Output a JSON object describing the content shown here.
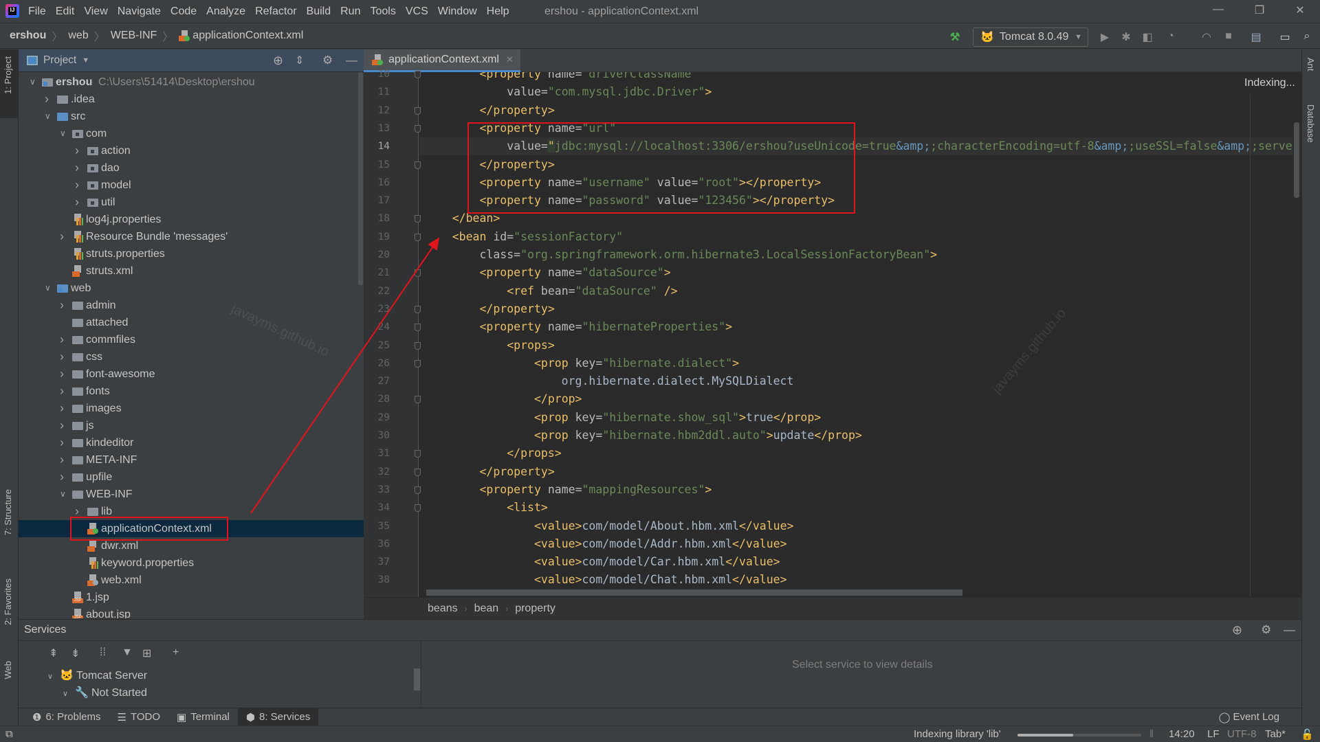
{
  "window": {
    "title": "ershou - applicationContext.xml",
    "minimize": "—",
    "restore": "❐",
    "close": "✕"
  },
  "menu": [
    "File",
    "Edit",
    "View",
    "Navigate",
    "Code",
    "Analyze",
    "Refactor",
    "Build",
    "Run",
    "Tools",
    "VCS",
    "Window",
    "Help"
  ],
  "breadcrumb": [
    "ershou",
    "web",
    "WEB-INF",
    "applicationContext.xml"
  ],
  "toolbar": {
    "run_config": "Tomcat 8.0.49",
    "build_icon": "hammer-icon"
  },
  "left_stripe": [
    "1: Project",
    "7: Structure",
    "2: Favorites",
    "Web"
  ],
  "right_stripe": [
    "Ant",
    "Database"
  ],
  "project": {
    "title": "Project",
    "tree": [
      {
        "label": "ershou",
        "path": "C:\\Users\\51414\\Desktop\\ershou",
        "depth": 0,
        "arrow": "open",
        "icon": "module"
      },
      {
        "label": ".idea",
        "depth": 1,
        "arrow": "closed",
        "icon": "folder"
      },
      {
        "label": "src",
        "depth": 1,
        "arrow": "open",
        "icon": "src"
      },
      {
        "label": "com",
        "depth": 2,
        "arrow": "open",
        "icon": "package"
      },
      {
        "label": "action",
        "depth": 3,
        "arrow": "closed",
        "icon": "package"
      },
      {
        "label": "dao",
        "depth": 3,
        "arrow": "closed",
        "icon": "package"
      },
      {
        "label": "model",
        "depth": 3,
        "arrow": "closed",
        "icon": "package"
      },
      {
        "label": "util",
        "depth": 3,
        "arrow": "closed",
        "icon": "package"
      },
      {
        "label": "log4j.properties",
        "depth": 2,
        "arrow": "none",
        "icon": "properties"
      },
      {
        "label": "Resource Bundle 'messages'",
        "depth": 2,
        "arrow": "closed",
        "icon": "properties"
      },
      {
        "label": "struts.properties",
        "depth": 2,
        "arrow": "none",
        "icon": "properties"
      },
      {
        "label": "struts.xml",
        "depth": 2,
        "arrow": "none",
        "icon": "xml"
      },
      {
        "label": "web",
        "depth": 1,
        "arrow": "open",
        "icon": "web"
      },
      {
        "label": "admin",
        "depth": 2,
        "arrow": "closed",
        "icon": "folder"
      },
      {
        "label": "attached",
        "depth": 2,
        "arrow": "none",
        "icon": "folder"
      },
      {
        "label": "commfiles",
        "depth": 2,
        "arrow": "closed",
        "icon": "folder"
      },
      {
        "label": "css",
        "depth": 2,
        "arrow": "closed",
        "icon": "folder"
      },
      {
        "label": "font-awesome",
        "depth": 2,
        "arrow": "closed",
        "icon": "folder"
      },
      {
        "label": "fonts",
        "depth": 2,
        "arrow": "closed",
        "icon": "folder"
      },
      {
        "label": "images",
        "depth": 2,
        "arrow": "closed",
        "icon": "folder"
      },
      {
        "label": "js",
        "depth": 2,
        "arrow": "closed",
        "icon": "folder"
      },
      {
        "label": "kindeditor",
        "depth": 2,
        "arrow": "closed",
        "icon": "folder"
      },
      {
        "label": "META-INF",
        "depth": 2,
        "arrow": "closed",
        "icon": "folder"
      },
      {
        "label": "upfile",
        "depth": 2,
        "arrow": "closed",
        "icon": "folder"
      },
      {
        "label": "WEB-INF",
        "depth": 2,
        "arrow": "open",
        "icon": "folder"
      },
      {
        "label": "lib",
        "depth": 3,
        "arrow": "closed",
        "icon": "folder"
      },
      {
        "label": "applicationContext.xml",
        "depth": 3,
        "arrow": "none",
        "icon": "spring-xml",
        "selected": true
      },
      {
        "label": "dwr.xml",
        "depth": 3,
        "arrow": "none",
        "icon": "xml"
      },
      {
        "label": "keyword.properties",
        "depth": 3,
        "arrow": "none",
        "icon": "properties"
      },
      {
        "label": "web.xml",
        "depth": 3,
        "arrow": "none",
        "icon": "web-xml"
      },
      {
        "label": "1.jsp",
        "depth": 2,
        "arrow": "none",
        "icon": "jsp"
      },
      {
        "label": "about.jsp",
        "depth": 2,
        "arrow": "none",
        "icon": "jsp"
      }
    ]
  },
  "editor": {
    "tab": "applicationContext.xml",
    "status": "Indexing...",
    "current_line": 14,
    "first_line": 10,
    "lines": [
      [
        [
          "txt",
          "        "
        ],
        [
          "tag",
          "<property "
        ],
        [
          "attr",
          "name="
        ],
        [
          "val",
          "\"driverClassName\""
        ]
      ],
      [
        [
          "txt",
          "            "
        ],
        [
          "attr",
          "value="
        ],
        [
          "val",
          "\"com.mysql.jdbc.Driver\""
        ],
        [
          "tag",
          ">"
        ]
      ],
      [
        [
          "txt",
          "        "
        ],
        [
          "tag",
          "</property>"
        ]
      ],
      [
        [
          "txt",
          "        "
        ],
        [
          "tag",
          "<property "
        ],
        [
          "attr",
          "name="
        ],
        [
          "val",
          "\"url\""
        ]
      ],
      [
        [
          "txt",
          "            "
        ],
        [
          "attr",
          "value="
        ],
        [
          "caret",
          "\""
        ],
        [
          "val",
          "jdbc:mysql://localhost:3306/ershou?useUnicode=true"
        ],
        [
          "ent",
          "&amp;"
        ],
        [
          "val",
          ";characterEncoding=utf-8"
        ],
        [
          "ent",
          "&amp;"
        ],
        [
          "val",
          ";useSSL=false"
        ],
        [
          "ent",
          "&amp;"
        ],
        [
          "val",
          ";serverTimezone=UTC\""
        ],
        [
          "tag",
          "/>"
        ]
      ],
      [
        [
          "txt",
          "        "
        ],
        [
          "tag",
          "</property>"
        ]
      ],
      [
        [
          "txt",
          "        "
        ],
        [
          "tag",
          "<property "
        ],
        [
          "attr",
          "name="
        ],
        [
          "val",
          "\"username\""
        ],
        [
          "attr",
          " value="
        ],
        [
          "val",
          "\"root\""
        ],
        [
          "tag",
          "></property>"
        ]
      ],
      [
        [
          "txt",
          "        "
        ],
        [
          "tag",
          "<property "
        ],
        [
          "attr",
          "name="
        ],
        [
          "val",
          "\"password\""
        ],
        [
          "attr",
          " value="
        ],
        [
          "val",
          "\"123456\""
        ],
        [
          "tag",
          "></property>"
        ]
      ],
      [
        [
          "txt",
          "    "
        ],
        [
          "tag",
          "</bean>"
        ]
      ],
      [
        [
          "txt",
          "    "
        ],
        [
          "tag",
          "<bean "
        ],
        [
          "attr",
          "id="
        ],
        [
          "val",
          "\"sessionFactory\""
        ]
      ],
      [
        [
          "txt",
          "        "
        ],
        [
          "attr",
          "class="
        ],
        [
          "val",
          "\"org.springframework.orm.hibernate3.LocalSessionFactoryBean\""
        ],
        [
          "tag",
          ">"
        ]
      ],
      [
        [
          "txt",
          "        "
        ],
        [
          "tag",
          "<property "
        ],
        [
          "attr",
          "name="
        ],
        [
          "val",
          "\"dataSource\""
        ],
        [
          "tag",
          ">"
        ]
      ],
      [
        [
          "txt",
          "            "
        ],
        [
          "tag",
          "<ref "
        ],
        [
          "attr",
          "bean="
        ],
        [
          "val",
          "\"dataSource\""
        ],
        [
          "tag",
          " />"
        ]
      ],
      [
        [
          "txt",
          "        "
        ],
        [
          "tag",
          "</property>"
        ]
      ],
      [
        [
          "txt",
          "        "
        ],
        [
          "tag",
          "<property "
        ],
        [
          "attr",
          "name="
        ],
        [
          "val",
          "\"hibernateProperties\""
        ],
        [
          "tag",
          ">"
        ]
      ],
      [
        [
          "txt",
          "            "
        ],
        [
          "tag",
          "<props>"
        ]
      ],
      [
        [
          "txt",
          "                "
        ],
        [
          "tag",
          "<prop "
        ],
        [
          "attr",
          "key="
        ],
        [
          "val",
          "\"hibernate.dialect\""
        ],
        [
          "tag",
          ">"
        ]
      ],
      [
        [
          "txt",
          "                    org.hibernate.dialect.MySQLDialect"
        ]
      ],
      [
        [
          "txt",
          "                "
        ],
        [
          "tag",
          "</prop>"
        ]
      ],
      [
        [
          "txt",
          "                "
        ],
        [
          "tag",
          "<prop "
        ],
        [
          "attr",
          "key="
        ],
        [
          "val",
          "\"hibernate.show_sql\""
        ],
        [
          "tag",
          ">"
        ],
        [
          "txt",
          "true"
        ],
        [
          "tag",
          "</prop>"
        ]
      ],
      [
        [
          "txt",
          "                "
        ],
        [
          "tag",
          "<prop "
        ],
        [
          "attr",
          "key="
        ],
        [
          "val",
          "\"hibernate.hbm2ddl.auto\""
        ],
        [
          "tag",
          ">"
        ],
        [
          "txt",
          "update"
        ],
        [
          "tag",
          "</prop>"
        ]
      ],
      [
        [
          "txt",
          "            "
        ],
        [
          "tag",
          "</props>"
        ]
      ],
      [
        [
          "txt",
          "        "
        ],
        [
          "tag",
          "</property>"
        ]
      ],
      [
        [
          "txt",
          "        "
        ],
        [
          "tag",
          "<property "
        ],
        [
          "attr",
          "name="
        ],
        [
          "val",
          "\"mappingResources\""
        ],
        [
          "tag",
          ">"
        ]
      ],
      [
        [
          "txt",
          "            "
        ],
        [
          "tag",
          "<list>"
        ]
      ],
      [
        [
          "txt",
          "                "
        ],
        [
          "tag",
          "<value>"
        ],
        [
          "txt",
          "com/model/About.hbm.xml"
        ],
        [
          "tag",
          "</value>"
        ]
      ],
      [
        [
          "txt",
          "                "
        ],
        [
          "tag",
          "<value>"
        ],
        [
          "txt",
          "com/model/Addr.hbm.xml"
        ],
        [
          "tag",
          "</value>"
        ]
      ],
      [
        [
          "txt",
          "                "
        ],
        [
          "tag",
          "<value>"
        ],
        [
          "txt",
          "com/model/Car.hbm.xml"
        ],
        [
          "tag",
          "</value>"
        ]
      ],
      [
        [
          "txt",
          "                "
        ],
        [
          "tag",
          "<value>"
        ],
        [
          "txt",
          "com/model/Chat.hbm.xml"
        ],
        [
          "tag",
          "</value>"
        ]
      ]
    ],
    "breadcrumbs": [
      "beans",
      "bean",
      "property"
    ]
  },
  "services": {
    "title": "Services",
    "tree": [
      {
        "label": "Tomcat Server",
        "depth": 0
      },
      {
        "label": "Not Started",
        "depth": 1
      }
    ],
    "empty_text": "Select service to view details"
  },
  "bottom_tabs": [
    {
      "label": "6: Problems",
      "icon": "problems-icon"
    },
    {
      "label": "TODO",
      "icon": "todo-icon"
    },
    {
      "label": "Terminal",
      "icon": "terminal-icon"
    },
    {
      "label": "8: Services",
      "icon": "services-icon",
      "active": true
    }
  ],
  "event_log": "Event Log",
  "status": {
    "indexing": "Indexing library 'lib'",
    "progress": 0.45,
    "position": "14:20",
    "line_sep": "LF",
    "encoding": "UTF-8",
    "indent": "Tab*"
  },
  "watermark": "javayms.github.io",
  "colors": {
    "annotation": "#e0141e",
    "tag": "#e8bf6a",
    "attr_value": "#6a8759",
    "selection": "#0d293e"
  }
}
